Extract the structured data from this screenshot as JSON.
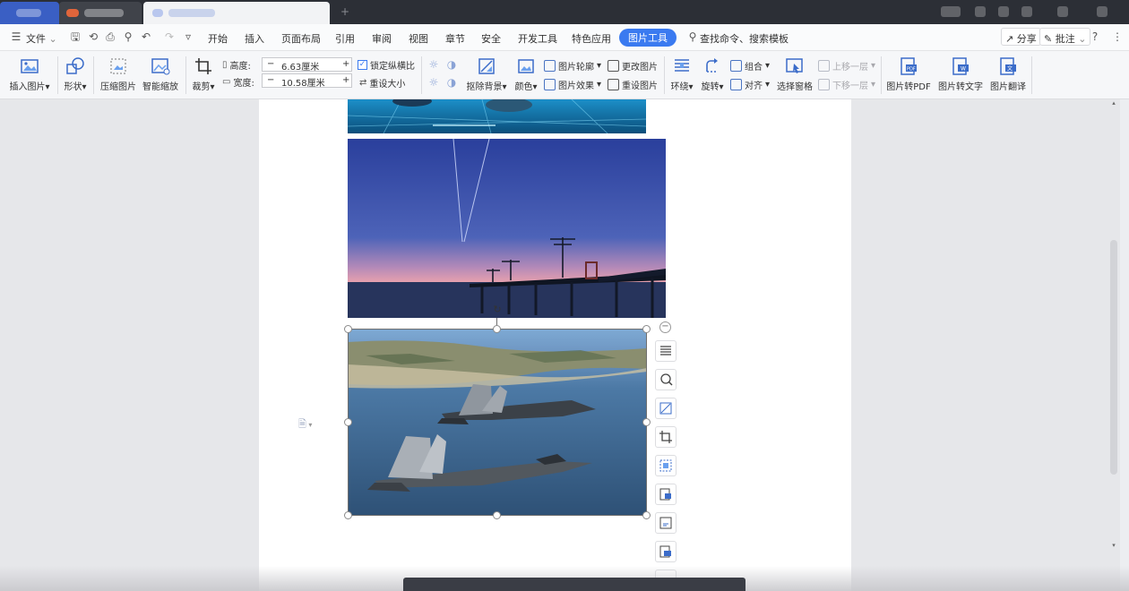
{
  "menu": {
    "file": "文件",
    "tabs": [
      "开始",
      "插入",
      "页面布局",
      "引用",
      "审阅",
      "视图",
      "章节",
      "安全",
      "开发工具",
      "特色应用"
    ],
    "active_tab": "图片工具",
    "search": "查找命令、搜索模板",
    "share": "分享",
    "comment": "批注"
  },
  "ribbon": {
    "insert_picture": "插入图片",
    "shape": "形状",
    "compress": "压缩图片",
    "smart_scale": "智能缩放",
    "crop": "裁剪",
    "height_label": "高度:",
    "height_value": "6.63厘米",
    "width_label": "宽度:",
    "width_value": "10.58厘米",
    "lock_ratio": "锁定纵横比",
    "reset_size": "重设大小",
    "remove_bg": "抠除背景",
    "color": "颜色",
    "outline": "图片轮廓",
    "effect": "图片效果",
    "change_picture": "更改图片",
    "reset_picture": "重设图片",
    "wrap": "环绕",
    "rotate": "旋转",
    "group": "组合",
    "align": "对齐",
    "selection_pane": "选择窗格",
    "bring_forward": "上移一层",
    "send_backward": "下移一层",
    "to_pdf": "图片转PDF",
    "to_text": "图片转文字",
    "translate": "图片翻译"
  },
  "colors": {
    "accent": "#3a7af0",
    "titlebar": "#2c2f36",
    "ribbon_bg": "#f6f7f9"
  }
}
